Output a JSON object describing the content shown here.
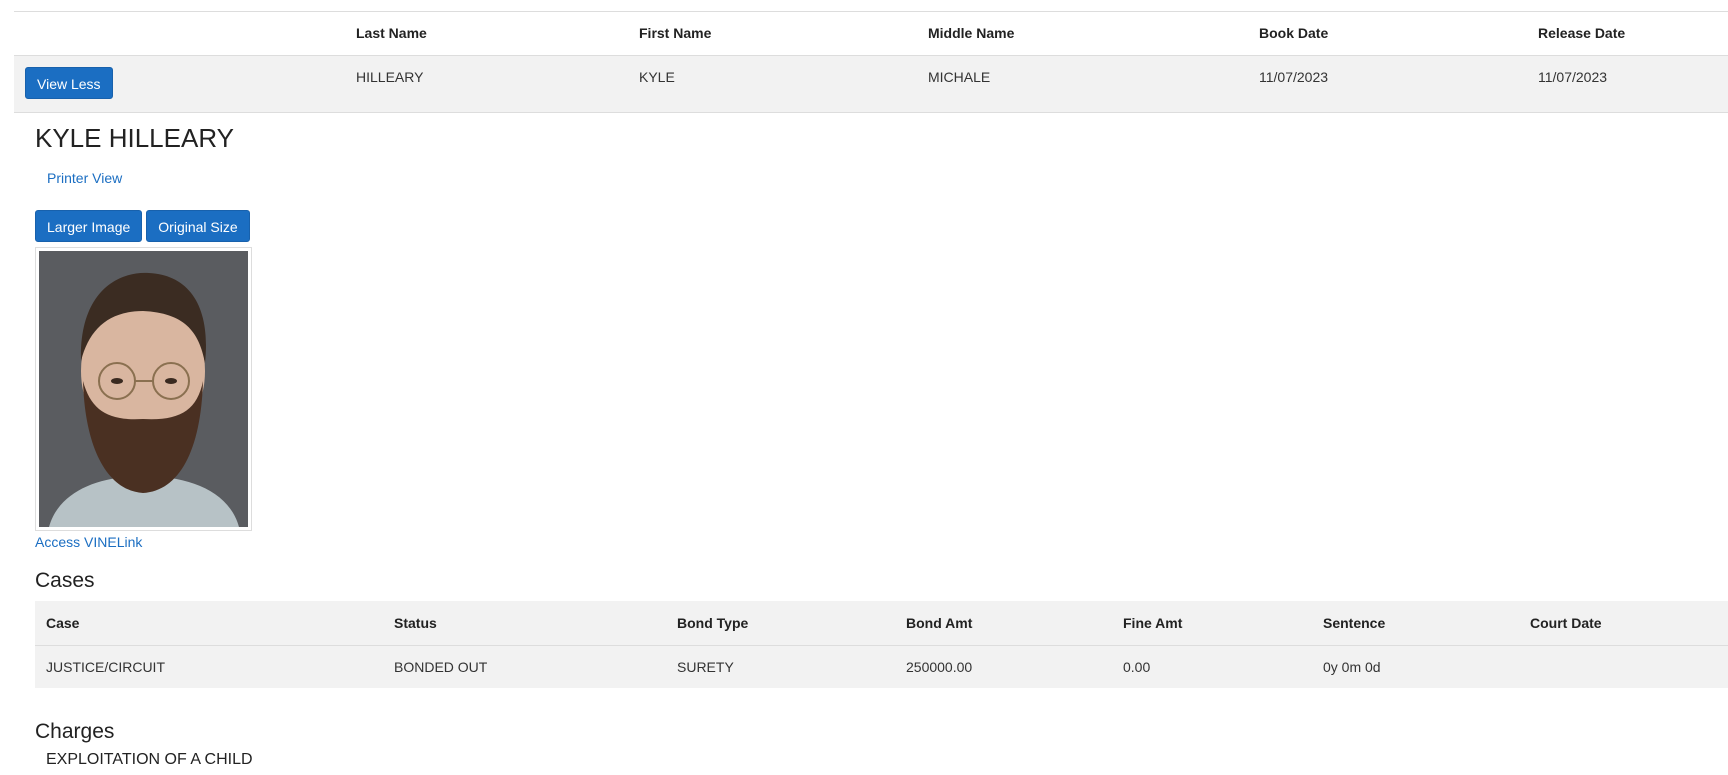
{
  "inmate_table": {
    "headers": [
      "Last Name",
      "First Name",
      "Middle Name",
      "Book Date",
      "Release Date"
    ],
    "row": {
      "view_button": "View Less",
      "last_name": "HILLEARY",
      "first_name": "KYLE",
      "middle_name": "MICHALE",
      "book_date": "11/07/2023",
      "release_date": "11/07/2023"
    }
  },
  "detail": {
    "name": "KYLE HILLEARY",
    "printer_view": "Printer View",
    "larger_image": "Larger Image",
    "original_size": "Original Size",
    "vinelink": "Access VINELink"
  },
  "cases": {
    "title": "Cases",
    "headers": [
      "Case",
      "Status",
      "Bond Type",
      "Bond Amt",
      "Fine Amt",
      "Sentence",
      "Court Date"
    ],
    "rows": [
      {
        "case": "JUSTICE/CIRCUIT",
        "status": "BONDED OUT",
        "bond_type": "SURETY",
        "bond_amt": "250000.00",
        "fine_amt": "0.00",
        "sentence": "0y 0m 0d",
        "court_date": ""
      }
    ]
  },
  "charges": {
    "title": "Charges",
    "items": [
      "EXPLOITATION OF A CHILD"
    ]
  },
  "colors": {
    "accent": "#1b6ec2",
    "row_bg": "#f2f2f2",
    "border": "#dddddd"
  }
}
